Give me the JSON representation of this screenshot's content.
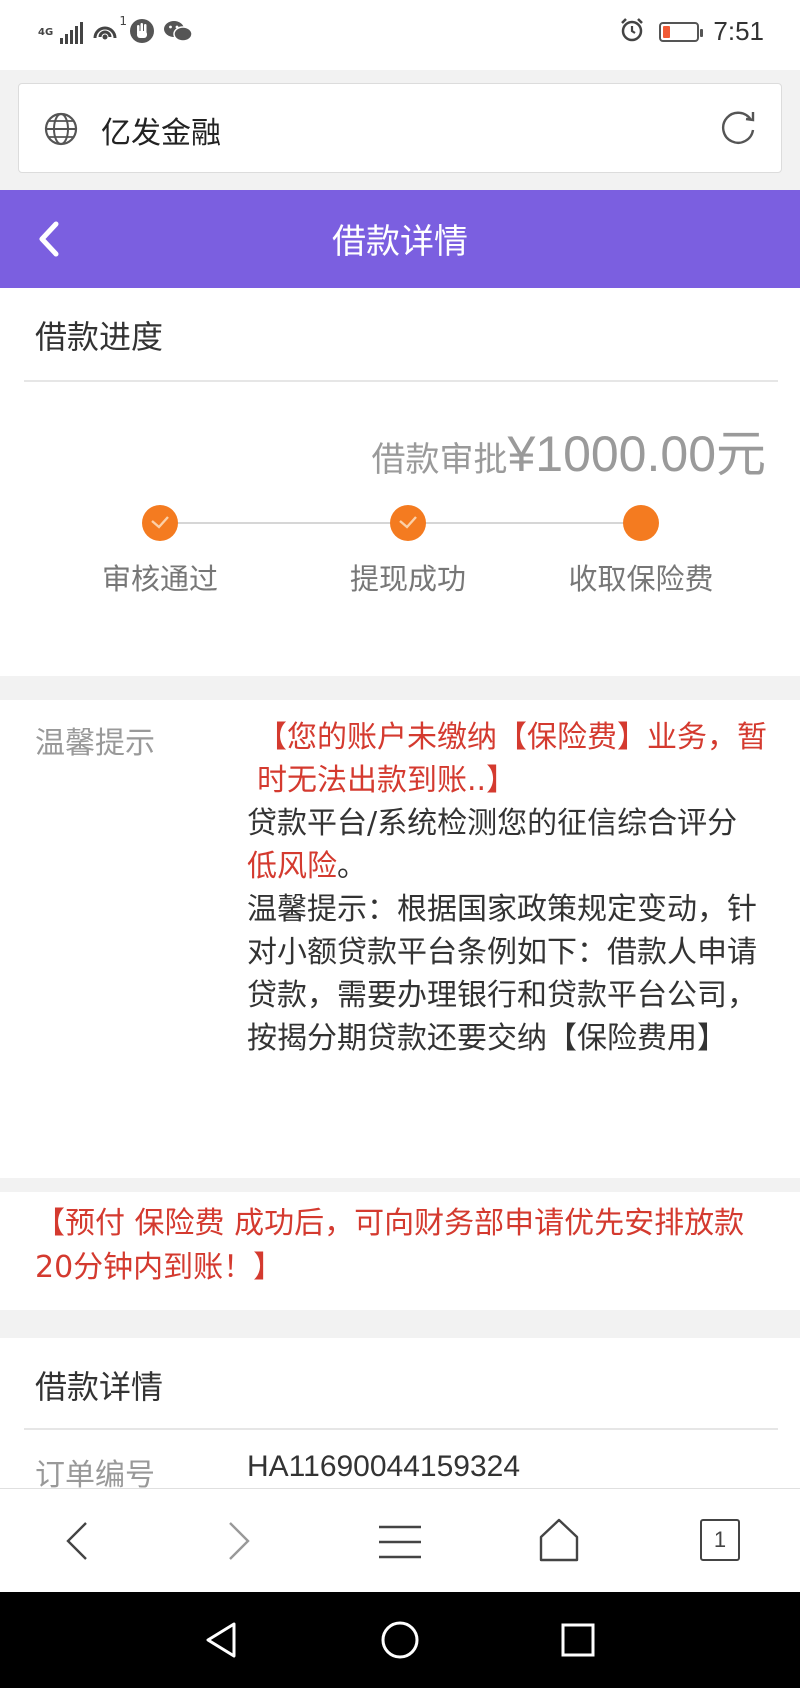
{
  "status_bar": {
    "network": "4G",
    "hotspot_count": "1",
    "time": "7:51",
    "battery_level": 0.2,
    "icons": [
      "signal-icon",
      "hotspot-icon",
      "hand-icon",
      "wechat-icon",
      "alarm-icon",
      "battery-icon"
    ]
  },
  "browser": {
    "page_title": "亿发金融",
    "icons": [
      "globe-icon",
      "reload-icon"
    ]
  },
  "header": {
    "title": "借款详情",
    "back_icon": "chevron-left-icon"
  },
  "progress": {
    "section_title": "借款进度",
    "amount_label": "借款审批",
    "amount_value": "¥1000.00元",
    "steps": [
      {
        "label": "审核通过",
        "done": true
      },
      {
        "label": "提现成功",
        "done": true
      },
      {
        "label": "收取保险费",
        "done": false
      }
    ],
    "accent_color": "#f47b20"
  },
  "notice": {
    "label": "温馨提示",
    "alert": "【您的账户未缴纳【保险费】业务，暂时无法出款到账..】",
    "line1_pre": "贷款平台/系统检测您的征信综合评分",
    "line1_red": "低风险",
    "line1_post": "。",
    "line2": "温馨提示：根据国家政策规定变动，针对小额贷款平台条例如下：借款人申请贷款，需要办理银行和贷款平台公司，按揭分期贷款还要交纳【保险费用】"
  },
  "prepay_notice": "【预付 保险费 成功后，可向财务部申请优先安排放款20分钟内到账！】",
  "detail": {
    "section_title": "借款详情",
    "order_label": "订单编号",
    "order_value": "HA11690044159324"
  },
  "bottom_bar": {
    "tab_count": "1",
    "icons": [
      "back-arrow-icon",
      "forward-arrow-icon",
      "menu-icon",
      "home-icon",
      "tabs-icon"
    ]
  },
  "colors": {
    "header_bg": "#7b5fe0",
    "alert_red": "#d43a2f"
  }
}
